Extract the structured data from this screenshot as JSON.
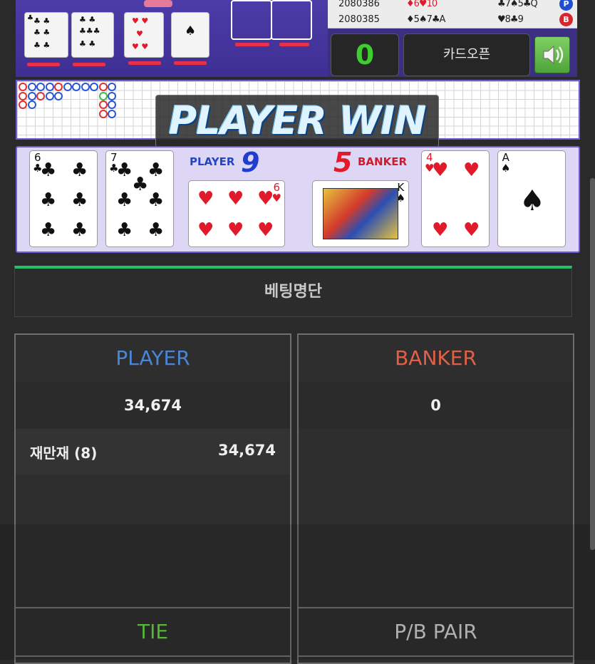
{
  "history": {
    "rows": [
      {
        "round": "2080386",
        "player_cards": "♦6♥10",
        "banker_cards": "♣7♠5♣Q",
        "mark": "P",
        "mark_color": "#1f4fd1"
      },
      {
        "round": "2080385",
        "player_cards": "♦5♠7♣A",
        "banker_cards": "♥8♣9",
        "mark": "B",
        "mark_color": "#d8262f"
      }
    ]
  },
  "controls": {
    "counter_value": "0",
    "card_open_label": "카드오픈",
    "sound_icon": "speaker-icon"
  },
  "result": {
    "banner": "PLAYER WIN",
    "player_label": "PLAYER",
    "player_score": "9",
    "banker_label": "BANKER",
    "banker_score": "5",
    "player_cards": [
      {
        "rank": "6",
        "suit": "♣",
        "color": "black"
      },
      {
        "rank": "7",
        "suit": "♣",
        "color": "black"
      },
      {
        "rank": "6",
        "suit": "♥",
        "color": "red"
      }
    ],
    "banker_cards": [
      {
        "rank": "K",
        "suit": "♠",
        "color": "black"
      },
      {
        "rank": "4",
        "suit": "♥",
        "color": "red"
      },
      {
        "rank": "A",
        "suit": "♠",
        "color": "black"
      }
    ]
  },
  "betting": {
    "title": "베팅명단",
    "panels": [
      {
        "title": "PLAYER",
        "title_color": "#4a86d6",
        "total": "34,674",
        "entries": [
          {
            "name": "재만재 (8)",
            "amount": "34,674"
          }
        ]
      },
      {
        "title": "BANKER",
        "title_color": "#e06049",
        "total": "0",
        "entries": []
      },
      {
        "title": "TIE",
        "title_color": "#5fd23d"
      },
      {
        "title": "P/B PAIR",
        "title_color": "#c9c9c9"
      }
    ]
  }
}
